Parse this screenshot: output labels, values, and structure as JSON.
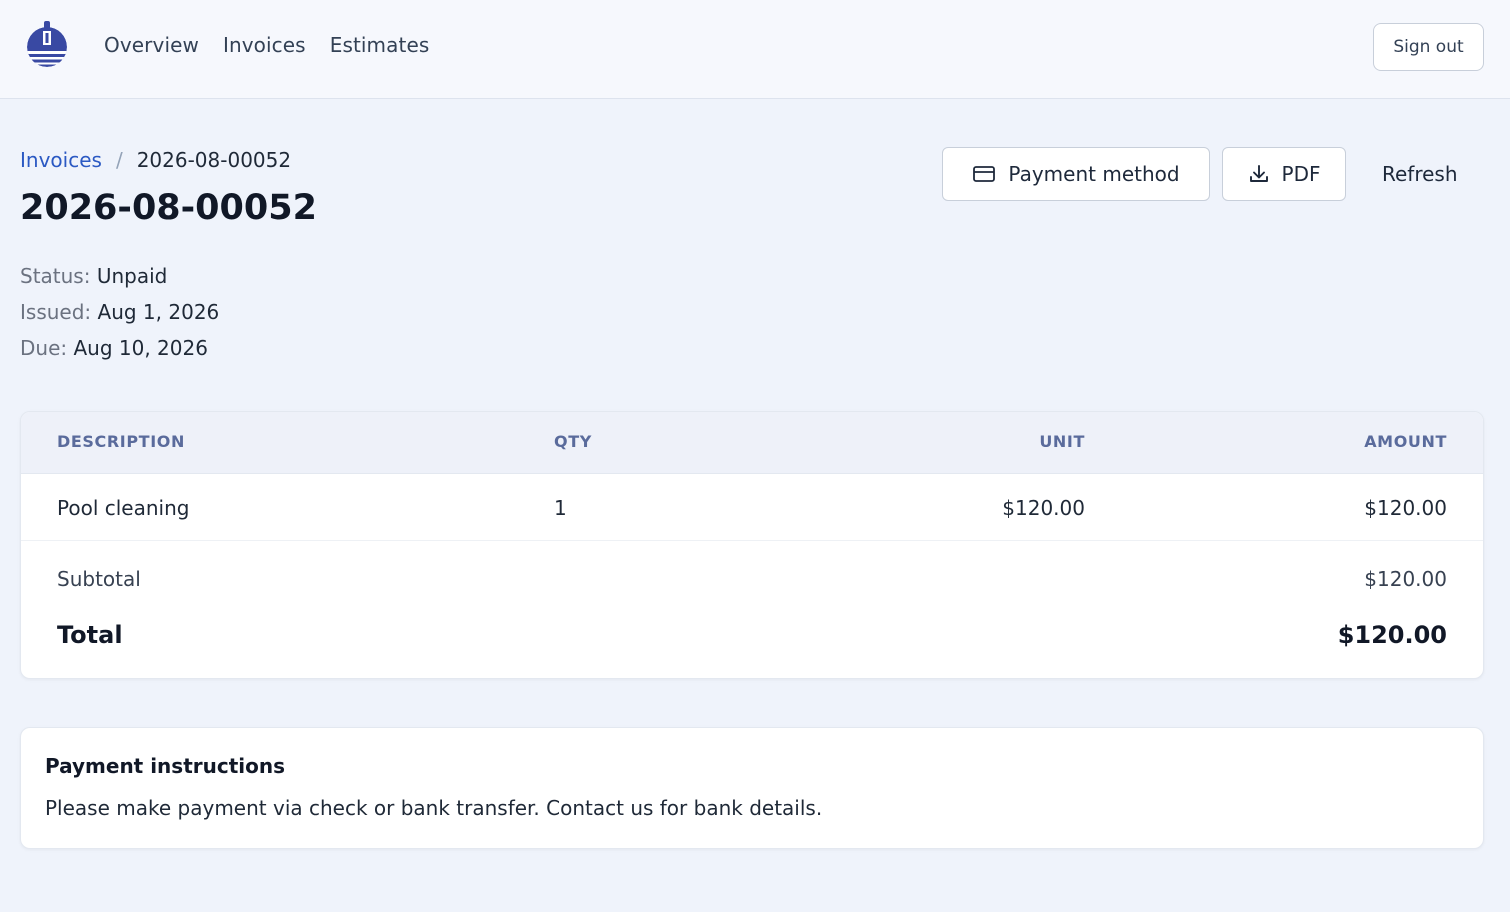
{
  "header": {
    "nav": [
      "Overview",
      "Invoices",
      "Estimates"
    ],
    "sign_out": "Sign out"
  },
  "breadcrumb": {
    "parent": "Invoices",
    "separator": "/",
    "current": "2026-08-00052"
  },
  "invoice": {
    "title": "2026-08-00052",
    "status_label": "Status:",
    "status": "Unpaid",
    "issued_label": "Issued:",
    "issued": "Aug 1, 2026",
    "due_label": "Due:",
    "due": "Aug 10, 2026"
  },
  "actions": {
    "payment_method": "Payment method",
    "pdf": "PDF",
    "refresh": "Refresh"
  },
  "table": {
    "columns": [
      "DESCRIPTION",
      "QTY",
      "UNIT",
      "AMOUNT"
    ],
    "rows": [
      {
        "description": "Pool cleaning",
        "qty": "1",
        "unit": "$120.00",
        "amount": "$120.00"
      }
    ],
    "subtotal_label": "Subtotal",
    "subtotal": "$120.00",
    "total_label": "Total",
    "total": "$120.00"
  },
  "payment_instructions": {
    "heading": "Payment instructions",
    "text": "Please make payment via check or bank transfer. Contact us for bank details."
  },
  "icons": {
    "logo": "sailboat-logo-icon",
    "payment": "credit-card-icon",
    "pdf": "download-icon"
  },
  "colors": {
    "accent": "#2b59c3",
    "logo": "#3949a3",
    "page_bg": "#eff3fb",
    "table_header_text": "#5a6b9c"
  }
}
